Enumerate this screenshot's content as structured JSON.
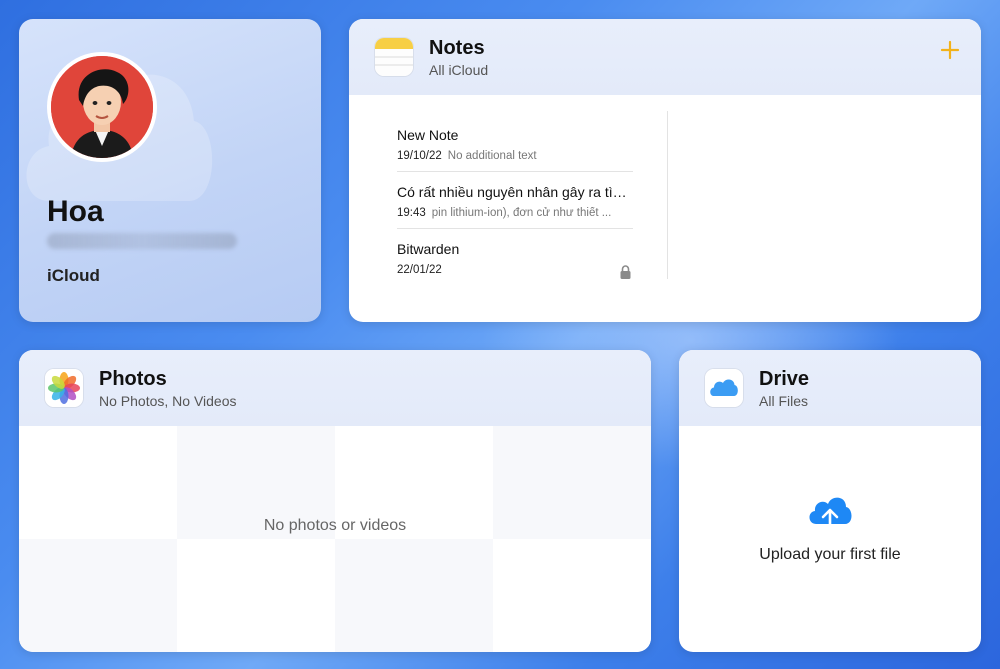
{
  "profile": {
    "name": "Hoa",
    "email": "",
    "service": "iCloud"
  },
  "notes": {
    "title": "Notes",
    "subtitle": "All iCloud",
    "add_icon": "plus-icon",
    "items": [
      {
        "title": "New Note",
        "date": "19/10/22",
        "preview": "No additional text",
        "locked": false
      },
      {
        "title": "Có rất nhiều nguyên nhân gây ra tìn...",
        "date": "19:43",
        "preview": "pin lithium-ion), đơn cử như thiết ...",
        "locked": false
      },
      {
        "title": "Bitwarden",
        "date": "22/01/22",
        "preview": "",
        "locked": true
      }
    ]
  },
  "photos": {
    "title": "Photos",
    "subtitle": "No Photos, No Videos",
    "empty_message": "No photos or videos"
  },
  "drive": {
    "title": "Drive",
    "subtitle": "All Files",
    "upload_label": "Upload your first file",
    "upload_icon": "cloud-upload-icon"
  },
  "colors": {
    "accent_notes": "#f2b21b",
    "accent_drive": "#1e88f5"
  }
}
